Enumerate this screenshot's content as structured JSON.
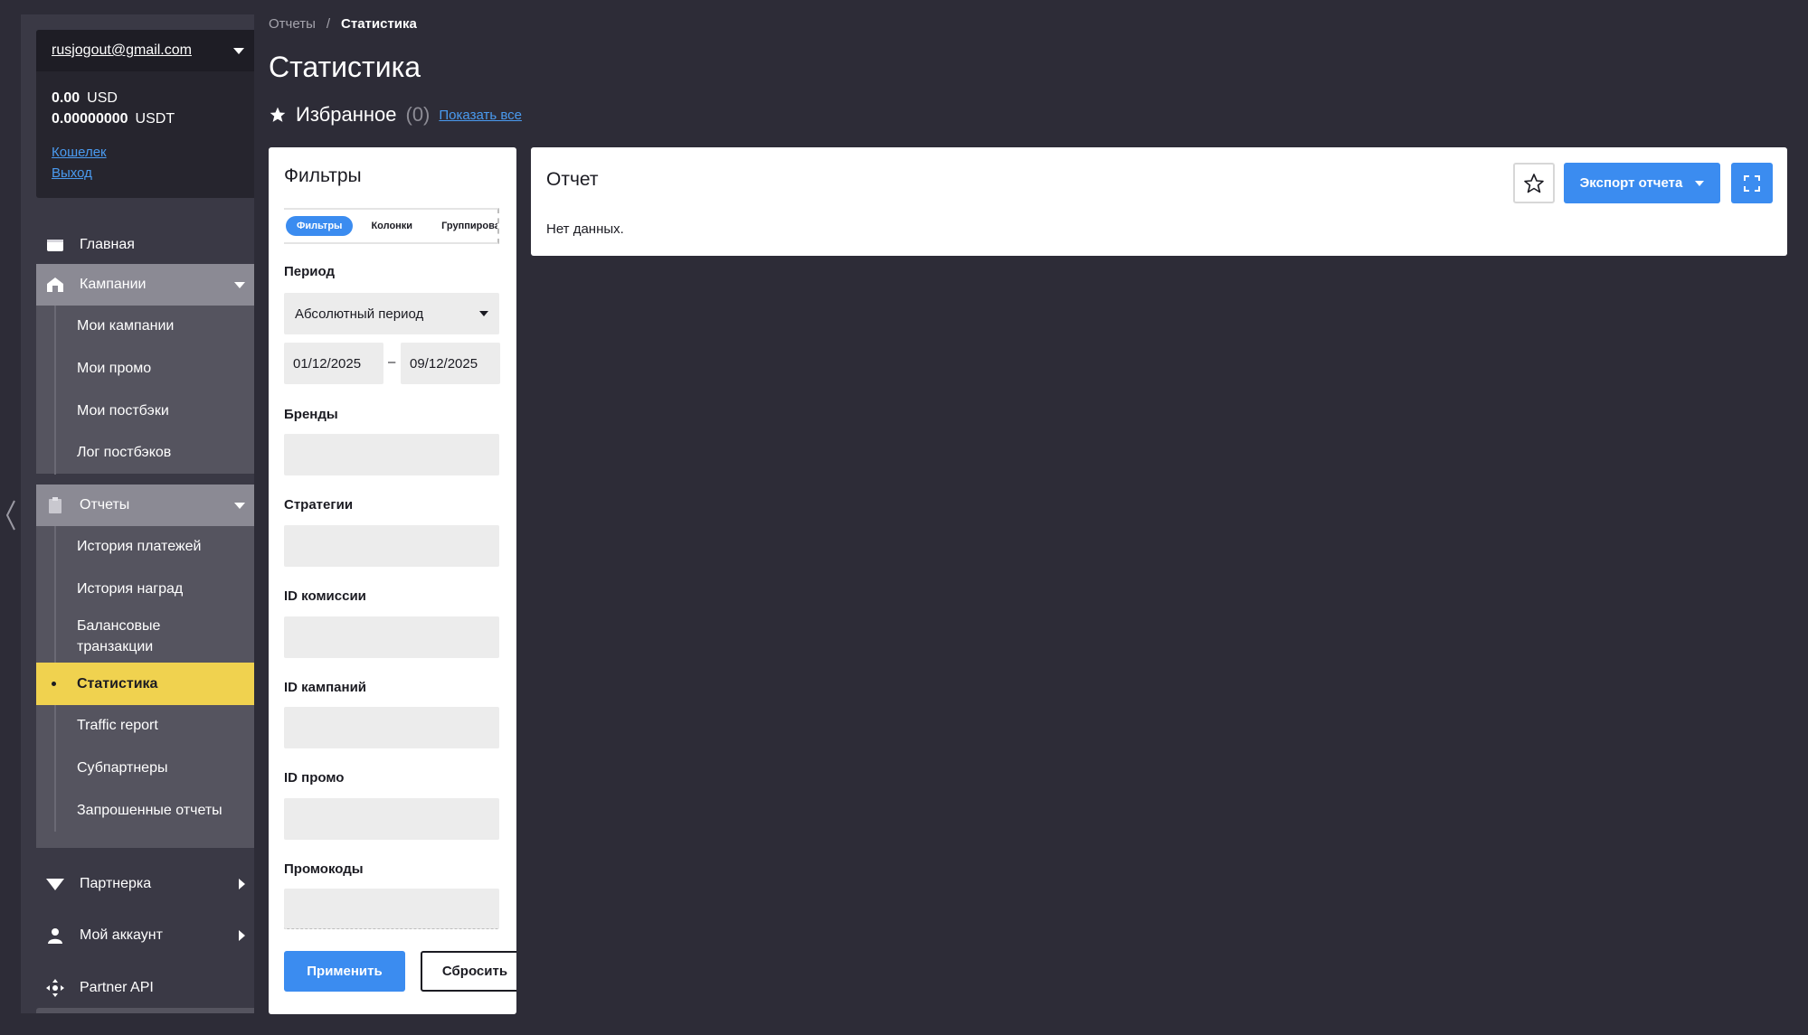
{
  "sidebar": {
    "account": {
      "email": "rusjogout@gmail.com",
      "balances": [
        {
          "amount": "0.00",
          "currency": "USD"
        },
        {
          "amount": "0.00000000",
          "currency": "USDT"
        }
      ],
      "wallet_link": "Кошелек",
      "logout_link": "Выход"
    },
    "home": "Главная",
    "campaigns": {
      "label": "Кампании",
      "items": [
        "Мои кампании",
        "Мои промо",
        "Мои постбэки",
        "Лог постбэков"
      ]
    },
    "reports": {
      "label": "Отчеты",
      "items": [
        "История платежей",
        "История наград",
        "Балансовые транзакции",
        "Статистика",
        "Traffic report",
        "Субпартнеры",
        "Запрошенные отчеты"
      ],
      "active": "Статистика"
    },
    "partner": "Партнерка",
    "my_account": "Мой аккаунт",
    "partner_api": "Partner API"
  },
  "breadcrumb": {
    "parent": "Отчеты",
    "separator": "/",
    "current": "Статистика"
  },
  "page_title": "Статистика",
  "favorites": {
    "label": "Избранное",
    "count": "(0)",
    "show_all": "Показать все"
  },
  "filters": {
    "title": "Фильтры",
    "tabs": [
      "Фильтры",
      "Колонки",
      "Группировать"
    ],
    "active_tab": "Фильтры",
    "period_label": "Период",
    "period_value": "Абсолютный период",
    "date_from": "01/12/2025",
    "date_separator": "–",
    "date_to": "09/12/2025",
    "brands_label": "Бренды",
    "strategies_label": "Стратегии",
    "commission_id_label": "ID комиссии",
    "campaign_id_label": "ID кампаний",
    "promo_id_label": "ID промо",
    "promocodes_label": "Промокоды",
    "apply": "Применить",
    "reset": "Сбросить"
  },
  "report": {
    "title": "Отчет",
    "no_data": "Нет данных.",
    "export": "Экспорт отчета"
  },
  "colors": {
    "background": "#2d2c37",
    "sidebar": "#3a3945",
    "accent_blue": "#3b8cf0",
    "active_yellow": "#f0d24f"
  },
  "icons": [
    "chevron-left-icon",
    "chevron-down-icon",
    "home-icon",
    "campaigns-icon",
    "clipboard-icon",
    "chevron-right-icon",
    "partner-icon",
    "user-icon",
    "api-icon",
    "star-icon",
    "expand-icon"
  ]
}
